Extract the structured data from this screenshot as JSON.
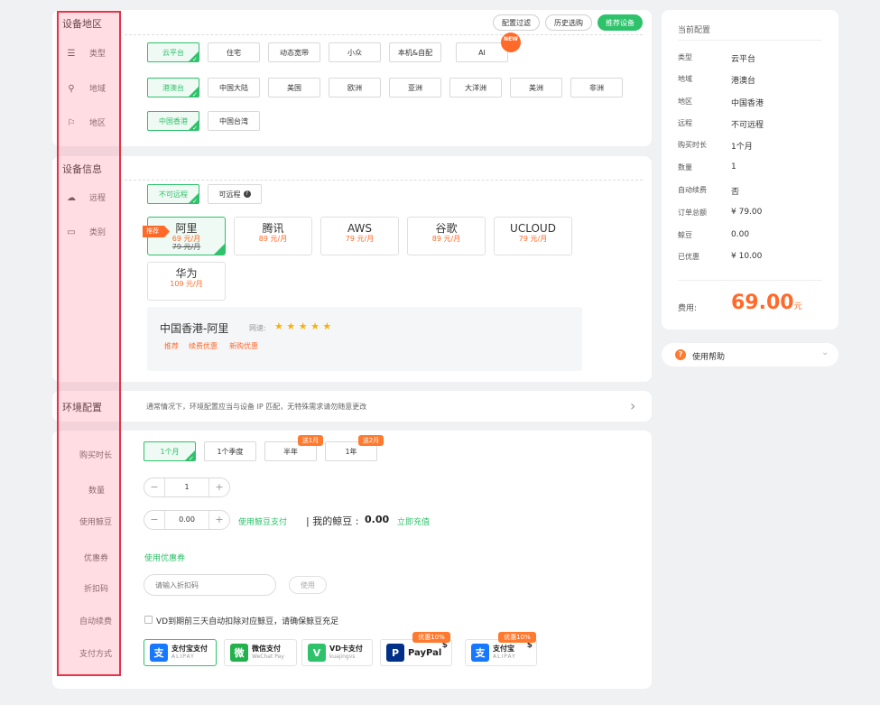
{
  "region_section": {
    "title": "设备地区",
    "top_pills": [
      "配置过滤",
      "历史选购",
      "推荐设备"
    ],
    "rows": [
      {
        "label": "类型",
        "icon": "layers-icon",
        "options": [
          "云平台",
          "住宅",
          "动态宽带",
          "小众",
          "本机&自配",
          "AI"
        ],
        "selected": 0,
        "new_badge": "NEW"
      },
      {
        "label": "地域",
        "icon": "location-icon",
        "options": [
          "港澳台",
          "中国大陆",
          "美国",
          "欧洲",
          "亚洲",
          "大洋洲",
          "美洲",
          "非洲"
        ],
        "selected": 0
      },
      {
        "label": "地区",
        "icon": "flag-icon",
        "options": [
          "中国香港",
          "中国台湾"
        ],
        "selected": 0
      }
    ]
  },
  "device_section": {
    "title": "设备信息",
    "remote_label": "远程",
    "remote_options": [
      "不可远程",
      "可远程"
    ],
    "remote_selected": 0,
    "category_label": "类别",
    "recommend_badge": "推荐",
    "vendors": [
      {
        "name": "阿里",
        "price": "69 元/月",
        "old": "79 元/月"
      },
      {
        "name": "腾讯",
        "price": "89 元/月"
      },
      {
        "name": "AWS",
        "price": "79 元/月"
      },
      {
        "name": "谷歌",
        "price": "89 元/月"
      },
      {
        "name": "UCLOUD",
        "price": "79 元/月"
      },
      {
        "name": "华为",
        "price": "109 元/月"
      }
    ],
    "detail": {
      "title": "中国香港-阿里",
      "speed_label": "网速:",
      "stars": "★ ★ ★ ★ ★",
      "tags": [
        "推荐",
        "续费优惠",
        "新购优惠"
      ]
    }
  },
  "env_section": {
    "title": "环境配置",
    "note": "通常情况下，环境配置应当与设备 IP 匹配，无特殊需求请勿随意更改",
    "chevron": "›"
  },
  "purchase": {
    "duration_label": "购买时长",
    "durations": [
      "1个月",
      "1个季度",
      "半年",
      "1年"
    ],
    "duration_badges": [
      "送1月",
      "送2月"
    ],
    "qty_label": "数量",
    "qty": "1",
    "beans_label": "使用鲸豆",
    "beans_value": "0.00",
    "use_beans": "使用鲸豆支付",
    "my_beans_label": "| 我的鲸豆 :",
    "my_beans": "0.00",
    "recharge": "立即充值",
    "coupon_label": "优惠券",
    "use_coupon": "使用优惠券",
    "discount_label": "折扣码",
    "discount_placeholder": "请输入折扣码",
    "use_btn": "使用",
    "auto_label": "自动续费",
    "auto_text": "VD到期前三天自动扣除对应鲸豆，请确保鲸豆充足",
    "pay_label": "支付方式",
    "minus": "−",
    "plus": "+",
    "payments": [
      {
        "name": "支付宝支付",
        "sub": "ALIPAY",
        "color": "#1677ff",
        "glyph": "支"
      },
      {
        "name": "微信支付",
        "sub": "WeChat Pay",
        "color": "#22b14c",
        "glyph": "微"
      },
      {
        "name": "VD卡支付",
        "sub": "kuajingvs",
        "color": "#2ec26b",
        "glyph": "V"
      },
      {
        "name": "PayPal",
        "sub": "",
        "color": "#003087",
        "glyph": "P",
        "badge": "优惠10%",
        "currency": "$"
      },
      {
        "name": "支付宝",
        "sub": "ALIPAY",
        "color": "#1677ff",
        "glyph": "支",
        "badge": "优惠10%",
        "currency": "$"
      }
    ]
  },
  "summary": {
    "title": "当前配置",
    "rows": [
      {
        "k": "类型",
        "v": "云平台"
      },
      {
        "k": "地域",
        "v": "港澳台"
      },
      {
        "k": "地区",
        "v": "中国香港"
      },
      {
        "k": "远程",
        "v": "不可远程"
      },
      {
        "k": "购买时长",
        "v": "1个月"
      },
      {
        "k": "数量",
        "v": "1"
      },
      {
        "k": "自动续费",
        "v": "否"
      },
      {
        "k": "订单总额",
        "v": "¥ 79.00"
      },
      {
        "k": "鲸豆",
        "v": "0.00"
      },
      {
        "k": "已优惠",
        "v": "¥ 10.00"
      }
    ],
    "fee_label": "费用:",
    "fee_value": "69.00",
    "fee_unit": "元"
  },
  "help": {
    "label": "使用帮助",
    "icon_glyph": "?",
    "chevron": "⌄"
  },
  "colors": {
    "accent": "#2ec26b",
    "orange": "#ff6a2a",
    "highlight": "#e4334a"
  }
}
